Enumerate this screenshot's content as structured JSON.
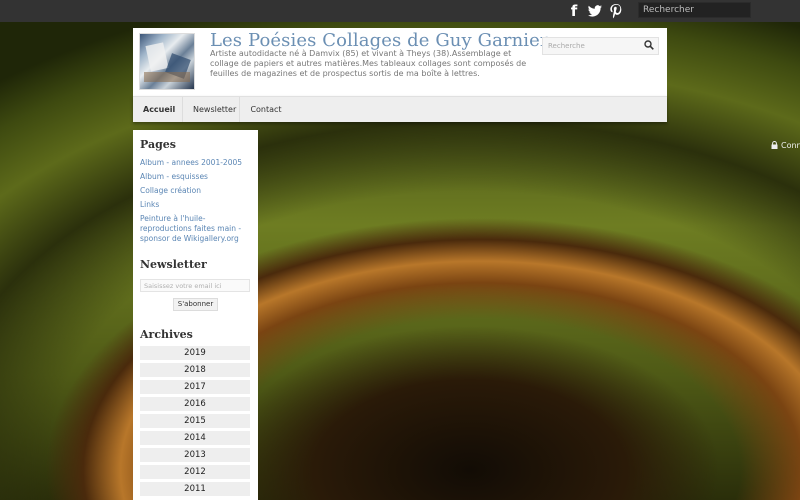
{
  "topbar": {
    "social": [
      {
        "name": "facebook-icon",
        "glyph": "f"
      },
      {
        "name": "twitter-icon",
        "glyph": "t"
      },
      {
        "name": "pinterest-icon",
        "glyph": "P"
      }
    ],
    "search_placeholder": "Rechercher"
  },
  "header": {
    "title": "Les Poésies Collages de Guy Garnier",
    "description": "Artiste autodidacte né à Damvix (85) et vivant à Theys (38).Assemblage et collage de papiers et autres matières.Mes tableaux collages sont composés de feuilles de magazines et de prospectus sortis de ma boîte à lettres.",
    "search_placeholder": "Recherche"
  },
  "nav": {
    "items": [
      "Accueil",
      "Newsletter",
      "Contact"
    ]
  },
  "connect_label": "Conn",
  "sidebar": {
    "pages_title": "Pages",
    "pages": [
      "Album - annees 2001-2005",
      "Album - esquisses",
      "Collage création",
      "Links",
      "Peinture à l'huile- reproductions faites main - sponsor de Wikigallery.org"
    ],
    "newsletter_title": "Newsletter",
    "email_placeholder": "Saisissez votre email ici",
    "subscribe_label": "S'abonner",
    "archives_title": "Archives",
    "years": [
      "2019",
      "2018",
      "2017",
      "2016",
      "2015",
      "2014",
      "2013",
      "2012",
      "2011"
    ]
  },
  "colors": {
    "topbar": "#333333",
    "title": "#6b8fb3",
    "link": "#5b86b4"
  }
}
